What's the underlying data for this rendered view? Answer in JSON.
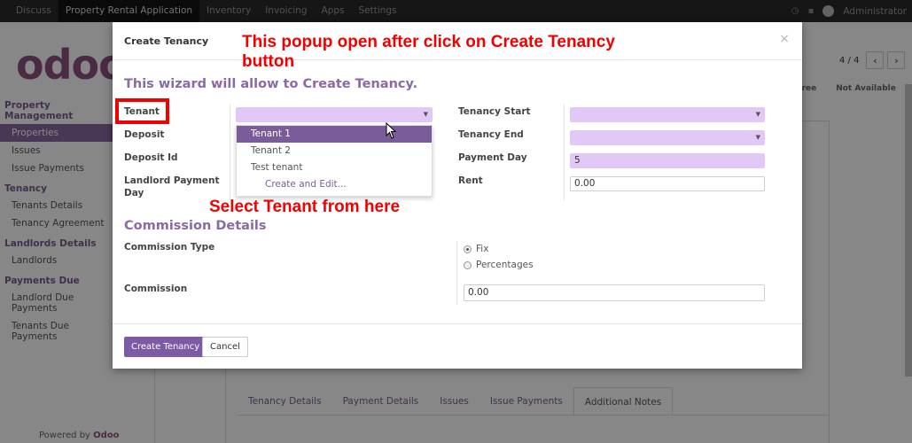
{
  "topbar": {
    "menu": [
      "Discuss",
      "Property Rental Application",
      "Inventory",
      "Invoicing",
      "Apps",
      "Settings"
    ],
    "user": "Administrator"
  },
  "logo": "odoo",
  "sidebar": {
    "sections": [
      {
        "title": "Property Management",
        "items": [
          "Properties",
          "Issues",
          "Issue Payments"
        ]
      },
      {
        "title": "Tenancy",
        "items": [
          "Tenants Details",
          "Tenancy Agreement"
        ]
      },
      {
        "title": "Landlords Details",
        "items": [
          "Landlords"
        ]
      },
      {
        "title": "Payments Due",
        "items": [
          "Landlord Due Payments",
          "Tenants Due Payments"
        ]
      }
    ],
    "powered_by": "Powered by",
    "powered_brand": "Odoo"
  },
  "pager": {
    "count": "4 / 4",
    "prev": "‹",
    "next": "›"
  },
  "status_bar": [
    "Free",
    "Not Available"
  ],
  "tabs": [
    "Tenancy Details",
    "Payment Details",
    "Issues",
    "Issue Payments",
    "Additional Notes"
  ],
  "modal": {
    "title": "Create Tenancy",
    "close": "×",
    "wizard_text": "This wizard will allow to Create Tenancy.",
    "labels": {
      "tenant": "Tenant",
      "deposit": "Deposit",
      "deposit_id": "Deposit Id",
      "landlord_payment_day_1": "Landlord Payment",
      "landlord_payment_day_2": "Day",
      "tenancy_start": "Tenancy Start",
      "tenancy_end": "Tenancy End",
      "payment_day": "Payment Day",
      "rent": "Rent",
      "commission_type": "Commission Type",
      "commission": "Commission"
    },
    "values": {
      "payment_day": "5",
      "rent": "0.00",
      "commission": "0.00"
    },
    "dropdown": [
      "Tenant 1",
      "Tenant 2",
      "Test tenant",
      "Create and Edit..."
    ],
    "commission_section": "Commission Details",
    "commission_options": [
      "Fix",
      "Percentages"
    ],
    "buttons": {
      "create": "Create Tenancy",
      "cancel": "Cancel"
    }
  },
  "annotations": {
    "popup_1": "This popup open after click on Create Tenancy",
    "popup_2": "button",
    "select": "Select Tenant from here"
  },
  "colors": {
    "annotation": "#f20000",
    "accent": "#7c5aa6",
    "field_required": "#e2c8f6"
  }
}
